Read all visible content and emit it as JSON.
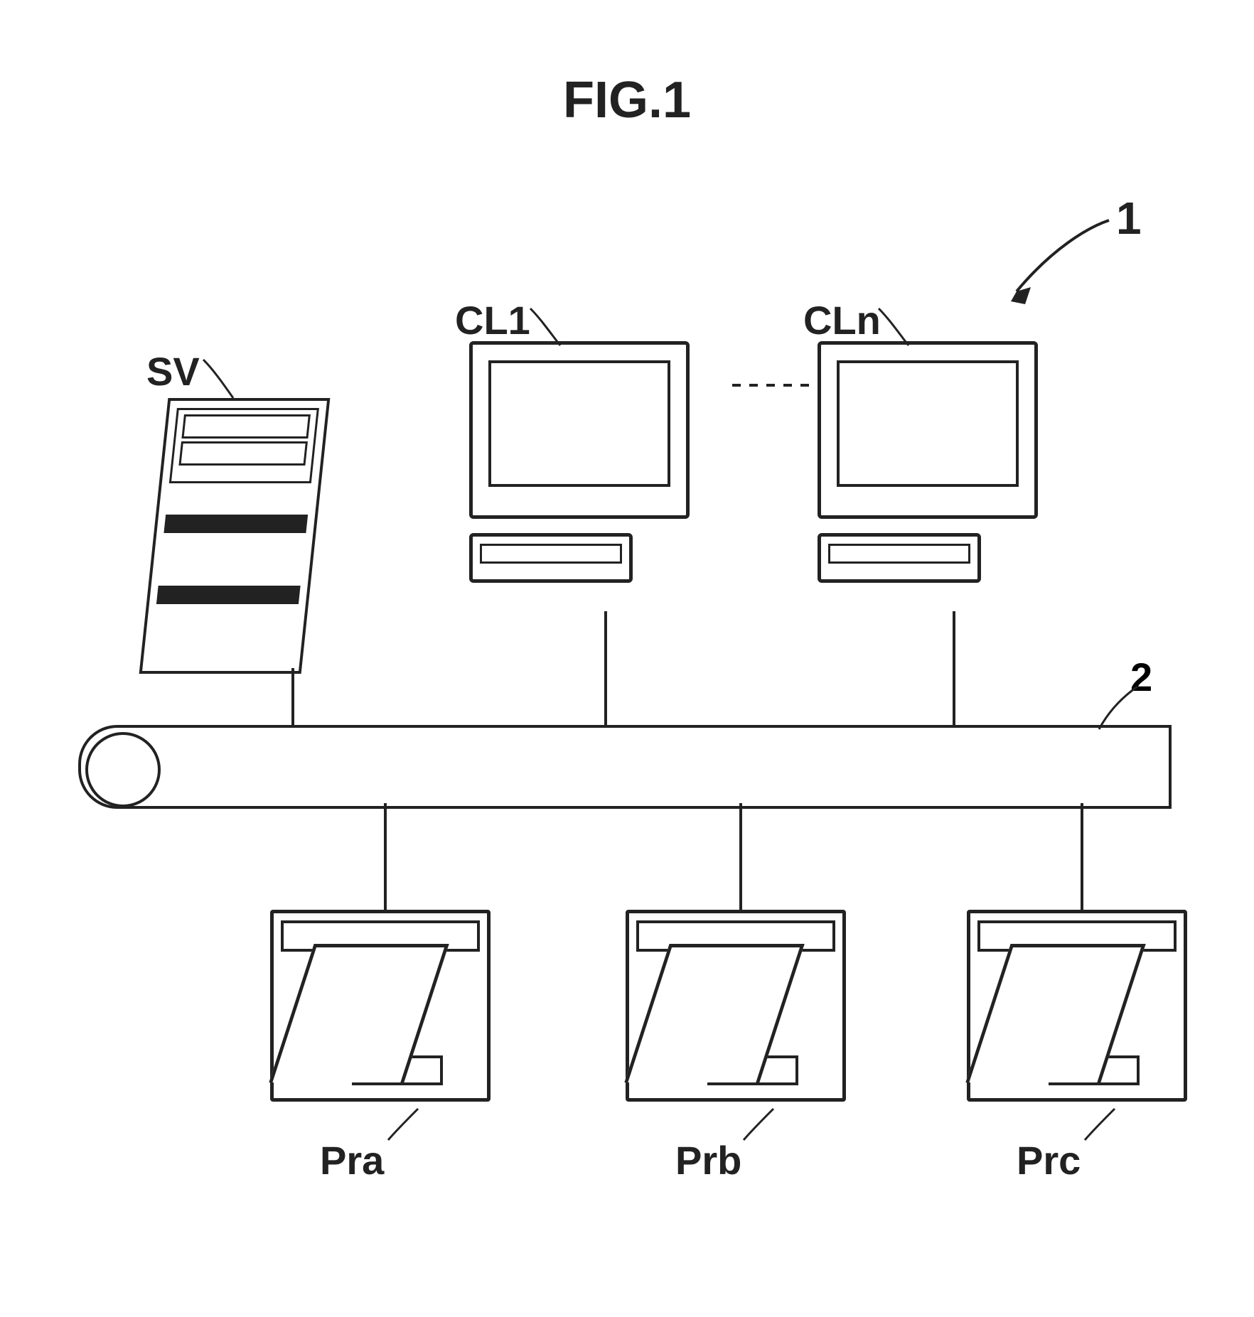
{
  "figure": {
    "title": "FIG.1",
    "system_ref": "1",
    "bus_ref": "2"
  },
  "server": {
    "label": "SV"
  },
  "clients": [
    {
      "label": "CL1"
    },
    {
      "label": "CLn"
    }
  ],
  "printers": [
    {
      "label": "Pra"
    },
    {
      "label": "Prb"
    },
    {
      "label": "Prc"
    }
  ],
  "icons": {
    "server": "server-tower-icon",
    "client": "desktop-computer-icon",
    "printer": "printer-icon",
    "bus": "network-bus-icon"
  }
}
